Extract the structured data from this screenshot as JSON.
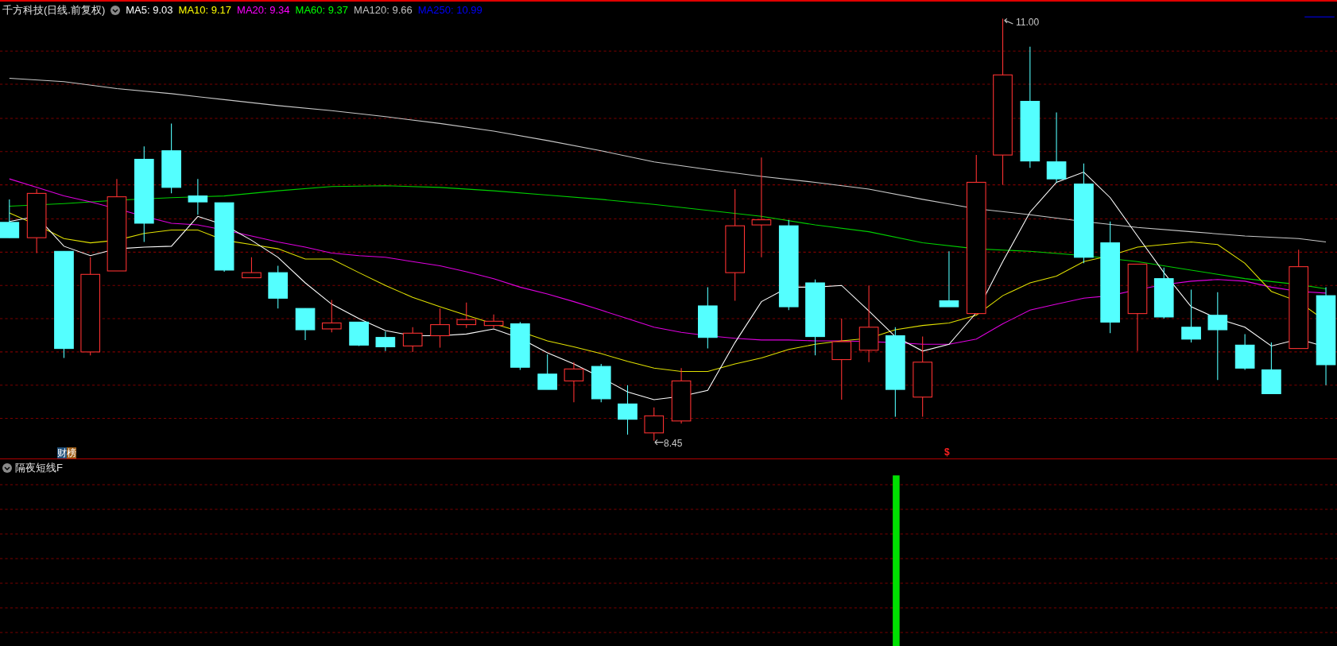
{
  "chart_header": {
    "title": "千方科技(日线.前复权)",
    "ma_items": [
      {
        "text": "MA5: 9.03",
        "color": "#ffffff"
      },
      {
        "text": "MA10: 9.17",
        "color": "#ffff00"
      },
      {
        "text": "MA20: 9.34",
        "color": "#ff00ff"
      },
      {
        "text": "MA60: 9.37",
        "color": "#00ff00"
      },
      {
        "text": "MA120: 9.66",
        "color": "#c0c0c0"
      },
      {
        "text": "MA250: 10.99",
        "color": "#0000ff"
      }
    ]
  },
  "price_chart": {
    "high_label": "11.00",
    "low_label": "8.45",
    "badge": [
      {
        "text": "财",
        "color": "#1f4e79"
      },
      {
        "text": "榜",
        "color": "#a0601a"
      }
    ],
    "marker": "$"
  },
  "indicator_panel": {
    "title": "隔夜短线F"
  }
}
